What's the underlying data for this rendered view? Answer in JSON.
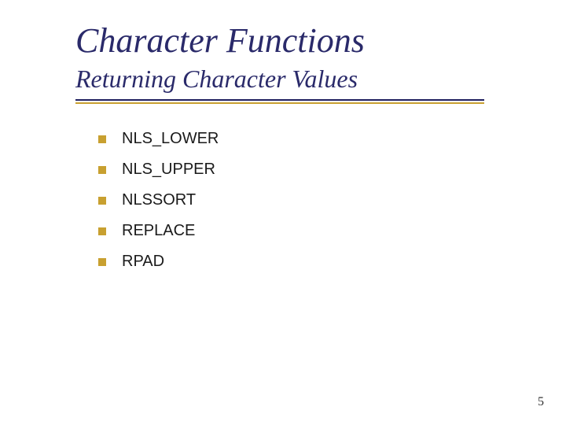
{
  "title": "Character Functions",
  "subtitle": "Returning Character Values",
  "bullets": [
    "NLS_LOWER",
    "NLS_UPPER",
    "NLSSORT",
    "REPLACE",
    "RPAD"
  ],
  "page_number": "5"
}
